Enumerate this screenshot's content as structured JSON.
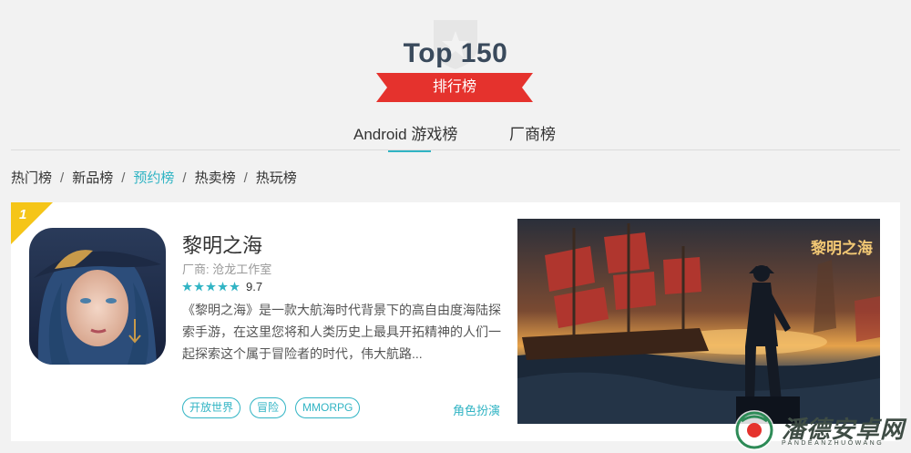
{
  "header": {
    "title": "Top 150",
    "ribbon_label": "排行榜"
  },
  "tabs": [
    {
      "label": "Android 游戏榜",
      "active": true
    },
    {
      "label": "厂商榜",
      "active": false
    }
  ],
  "filters": [
    {
      "label": "热门榜",
      "active": false
    },
    {
      "label": "新品榜",
      "active": false
    },
    {
      "label": "预约榜",
      "active": true
    },
    {
      "label": "热卖榜",
      "active": false
    },
    {
      "label": "热玩榜",
      "active": false
    }
  ],
  "filter_separator": "/",
  "card": {
    "rank": "1",
    "name": "黎明之海",
    "developer": "厂商: 沧龙工作室",
    "rating_stars": 5,
    "score": "9.7",
    "description": "《黎明之海》是一款大航海时代背景下的高自由度海陆探索手游，在这里您将和人类历史上最具开拓精神的人们一起探索这个属于冒险者的时代，伟大航路...",
    "tags": [
      "开放世界",
      "冒险",
      "MMORPG"
    ],
    "genre": "角色扮演",
    "screenshot_logo": "黎明之海"
  },
  "watermark": {
    "text": "潘德安卓网",
    "sub": "PANDEANZHUOWANG"
  },
  "colors": {
    "accent": "#31b4c4",
    "ribbon": "#e5322d",
    "rank_badge": "#f5c518"
  },
  "icons": [
    "trophy-badge-icon",
    "star-icon",
    "watermark-logo-icon"
  ]
}
